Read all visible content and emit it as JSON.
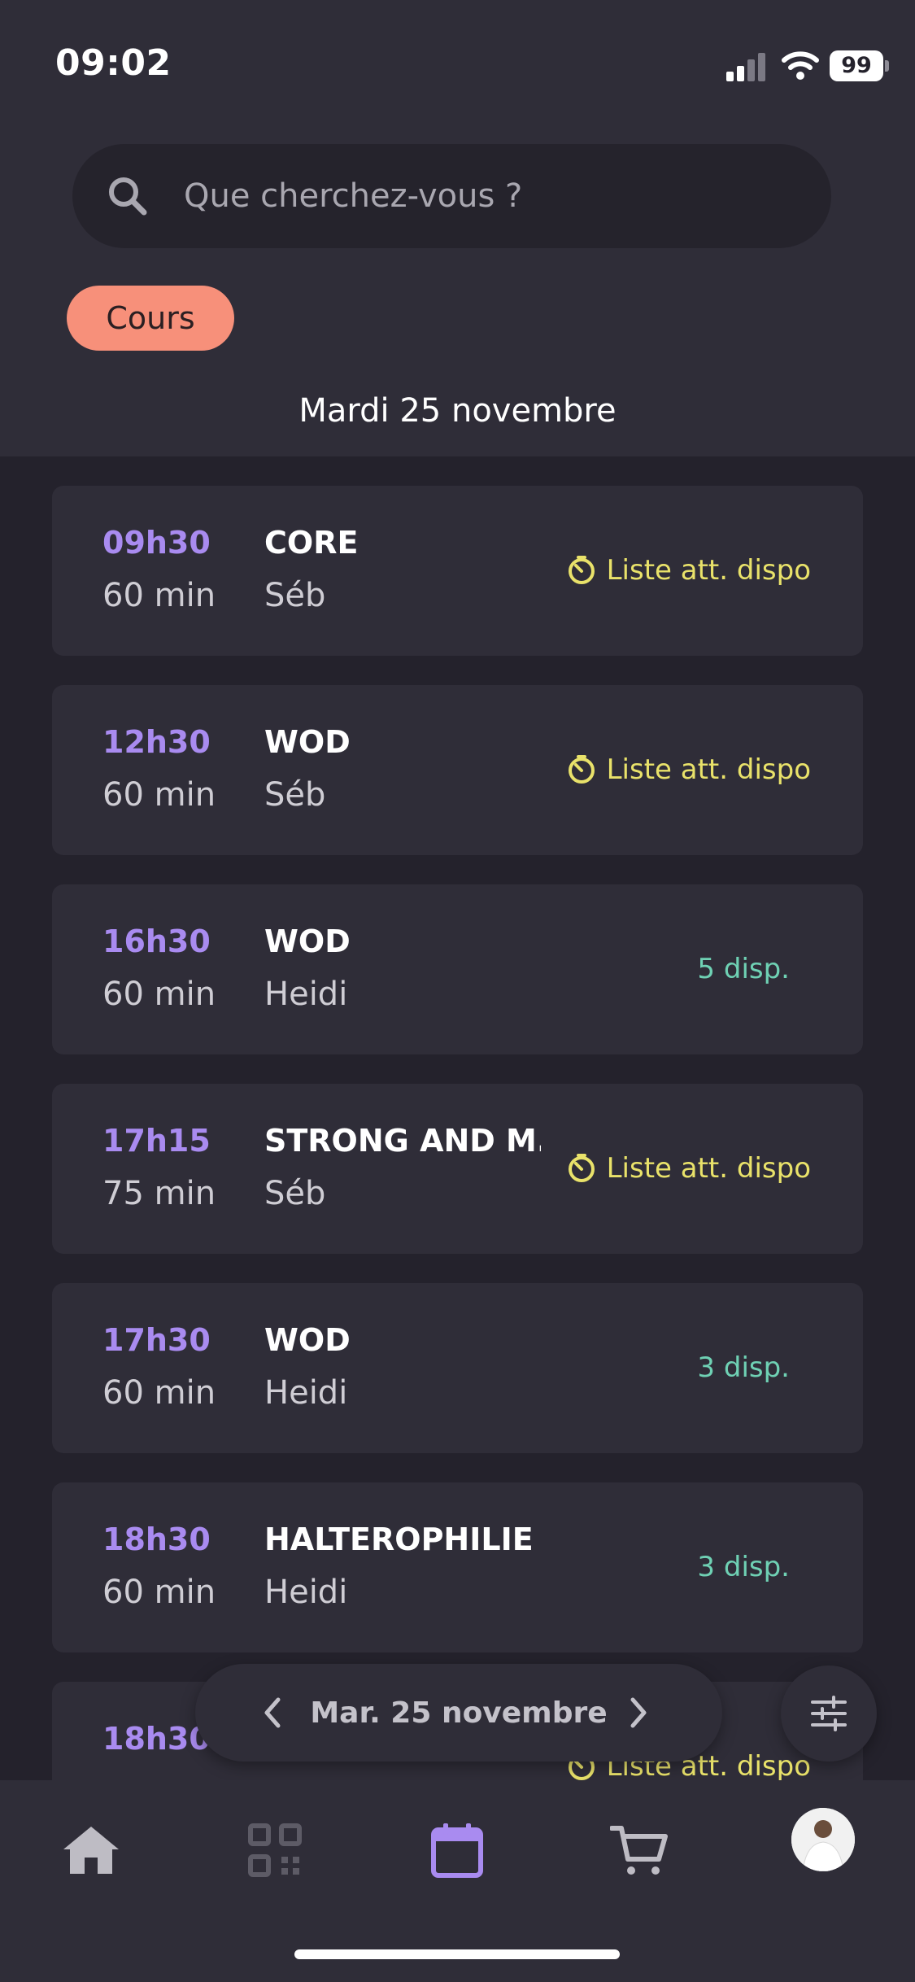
{
  "status_bar": {
    "time": "09:02",
    "battery": "99"
  },
  "search": {
    "placeholder": "Que cherchez-vous ?"
  },
  "filter_chip": {
    "label": "Cours"
  },
  "date_heading": "Mardi 25 novembre",
  "classes": [
    {
      "time": "09h30",
      "duration": "60 min",
      "name": "CORE",
      "coach": "Séb",
      "status": "Liste att. dispo",
      "status_type": "waitlist"
    },
    {
      "time": "12h30",
      "duration": "60 min",
      "name": "WOD",
      "coach": "Séb",
      "status": "Liste att. dispo",
      "status_type": "waitlist"
    },
    {
      "time": "16h30",
      "duration": "60 min",
      "name": "WOD",
      "coach": "Heidi",
      "status": "5 disp.",
      "status_type": "available"
    },
    {
      "time": "17h15",
      "duration": "75 min",
      "name": "STRONG AND M...",
      "coach": "Séb",
      "status": "Liste att. dispo",
      "status_type": "waitlist"
    },
    {
      "time": "17h30",
      "duration": "60 min",
      "name": "WOD",
      "coach": "Heidi",
      "status": "3 disp.",
      "status_type": "available"
    },
    {
      "time": "18h30",
      "duration": "60 min",
      "name": "HALTEROPHILIE",
      "coach": "Heidi",
      "status": "3 disp.",
      "status_type": "available"
    },
    {
      "time": "18h30",
      "duration": "",
      "name": "",
      "coach": "",
      "status": "Liste att. dispo",
      "status_type": "waitlist"
    }
  ],
  "date_nav": {
    "label": "Mar. 25 novembre"
  },
  "tabbar": {
    "items": [
      {
        "icon": "home-icon"
      },
      {
        "icon": "qr-code-icon"
      },
      {
        "icon": "calendar-icon",
        "active": true
      },
      {
        "icon": "cart-icon"
      },
      {
        "icon": "avatar"
      }
    ]
  },
  "colors": {
    "accent": "#a98bf0",
    "chip": "#f7907a",
    "waitlist": "#e9e26a",
    "available": "#6fd1b4",
    "background": "#24222c",
    "card": "#2f2d38"
  }
}
